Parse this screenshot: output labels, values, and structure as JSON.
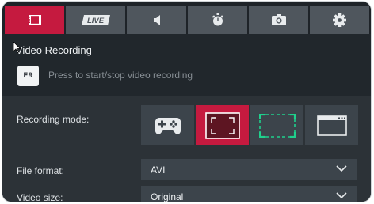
{
  "tabs": [
    {
      "id": "video",
      "icon": "film-icon",
      "active": true
    },
    {
      "id": "live",
      "label": "LIVE",
      "icon": "live-badge-icon",
      "active": false
    },
    {
      "id": "audio",
      "icon": "speaker-icon",
      "active": false
    },
    {
      "id": "benchmark",
      "icon": "stopwatch-icon",
      "active": false
    },
    {
      "id": "screenshot",
      "icon": "camera-icon",
      "active": false
    },
    {
      "id": "settings",
      "icon": "gear-icon",
      "active": false
    }
  ],
  "video_recording": {
    "title": "Video Recording",
    "hotkey": "F9",
    "hotkey_description": "Press to start/stop video recording"
  },
  "recording_mode": {
    "label": "Recording mode:",
    "options": [
      {
        "id": "game",
        "icon": "gamepad-icon",
        "selected": false
      },
      {
        "id": "fullscreen",
        "icon": "fullscreen-icon",
        "selected": true
      },
      {
        "id": "region",
        "icon": "region-select-icon",
        "selected": false
      },
      {
        "id": "window",
        "icon": "window-icon",
        "selected": false
      }
    ]
  },
  "file_format": {
    "label": "File format:",
    "value": "AVI"
  },
  "video_size": {
    "label": "Video size:",
    "value": "Original"
  },
  "colors": {
    "accent": "#c51a3f",
    "tab_inactive": "#4f565d",
    "panel_dark": "#21272c",
    "panel": "#2c3237",
    "control": "#3c444b",
    "region_green": "#1fd08c"
  }
}
